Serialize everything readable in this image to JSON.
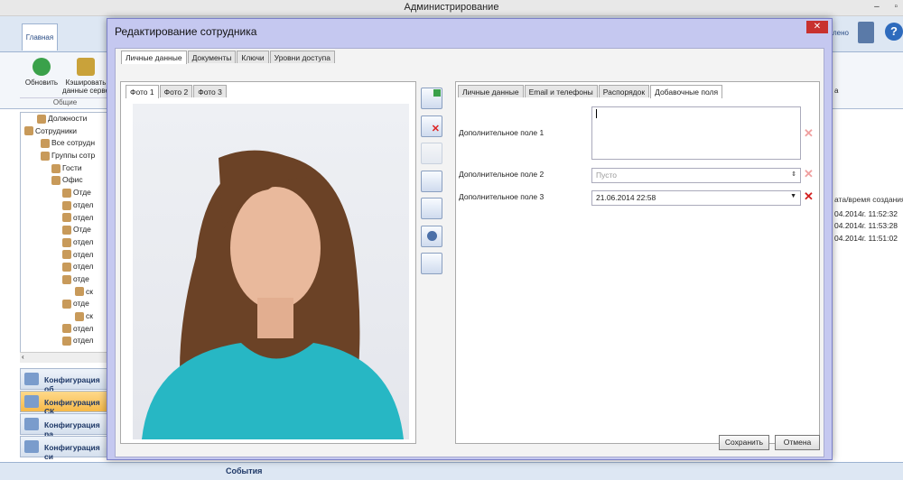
{
  "app": {
    "title": "Администрирование",
    "win_minimize": "–",
    "win_restore": "▫"
  },
  "ribbon": {
    "tab_main": "Главная",
    "refresh": "Обновить",
    "cache": "Кэшировать данные серве",
    "group": "Общие",
    "right_label": "лено",
    "right_sub": "а"
  },
  "tree": {
    "items": [
      "Должности",
      "Сотрудники",
      "Все сотрудн",
      "Группы сотр",
      "Гости",
      "Офис",
      "Отде",
      "отдел",
      "отдел",
      "Отде",
      "отдел",
      "отдел",
      "отдел",
      "отде",
      "ск",
      "отде",
      "ск",
      "отдел",
      "отдел"
    ]
  },
  "nav": {
    "items": [
      "Конфигурация об",
      "Конфигурация СК",
      "Конфигурация ра",
      "Конфигурация си"
    ]
  },
  "right": {
    "header": "ата/время создания",
    "rows": [
      "04.2014г. 11:52:32",
      "04.2014г. 11:53:28",
      "04.2014г. 11:51:02"
    ]
  },
  "status": {
    "events": "События"
  },
  "dialog": {
    "title": "Редактирование сотрудника",
    "close": "✕",
    "tabs": [
      "Личные данные",
      "Документы",
      "Ключи",
      "Уровни доступа"
    ],
    "photo_tabs": [
      "Фото 1",
      "Фото 2",
      "Фото 3"
    ],
    "inner_tabs": [
      "Личные данные",
      "Email и телефоны",
      "Распорядок",
      "Добавочные поля"
    ],
    "fields": {
      "f1_label": "Дополнительное поле 1",
      "f2_label": "Дополнительное поле 2",
      "f2_placeholder": "Пусто",
      "f3_label": "Дополнительное поле 3",
      "f3_value": "21.06.2014 22:58"
    },
    "save": "Сохранить",
    "cancel": "Отмена"
  }
}
